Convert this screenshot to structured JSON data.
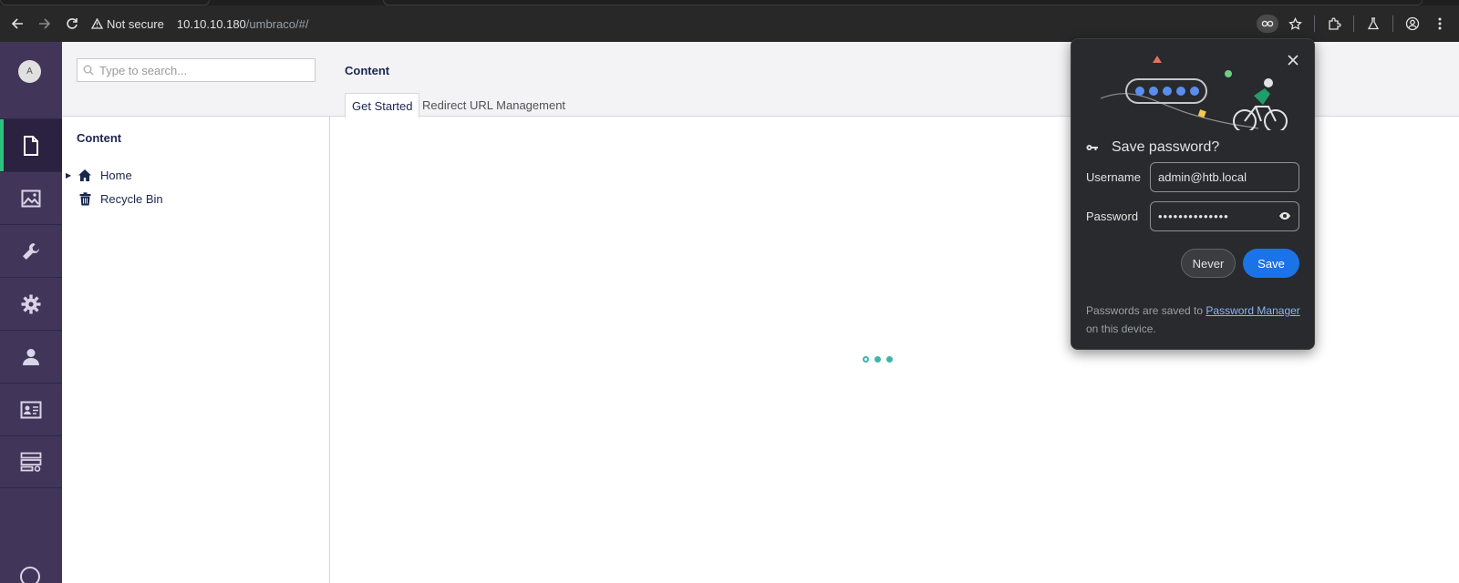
{
  "browser": {
    "security_label": "Not secure",
    "url_host": "10.10.10.180",
    "url_path": "/umbraco/#/"
  },
  "sidebar": {
    "avatar_initial": "A",
    "sections": [
      {
        "icon": "document-icon",
        "active": true
      },
      {
        "icon": "image-icon",
        "active": false
      },
      {
        "icon": "wrench-icon",
        "active": false
      },
      {
        "icon": "gear-icon",
        "active": false
      },
      {
        "icon": "user-icon",
        "active": false
      },
      {
        "icon": "id-card-icon",
        "active": false
      },
      {
        "icon": "form-icon",
        "active": false
      }
    ]
  },
  "tree": {
    "search_placeholder": "Type to search...",
    "title": "Content",
    "items": [
      {
        "label": "Home",
        "icon": "home-icon"
      },
      {
        "label": "Recycle Bin",
        "icon": "trash-icon"
      }
    ]
  },
  "main": {
    "title": "Content",
    "tabs": [
      {
        "label": "Get Started",
        "active": true
      },
      {
        "label": "Redirect URL Management",
        "active": false
      }
    ]
  },
  "password_bubble": {
    "heading": "Save password?",
    "username_label": "Username",
    "username_value": "admin@htb.local",
    "password_label": "Password",
    "password_value": "••••••••••••••",
    "never_label": "Never",
    "save_label": "Save",
    "footer_prefix": "Passwords are saved to ",
    "footer_link": "Password Manager",
    "footer_suffix": " on this device."
  },
  "colors": {
    "sidebar_bg": "#413659",
    "accent_blue": "#1a73e8",
    "loader": "#3bb7a8"
  }
}
